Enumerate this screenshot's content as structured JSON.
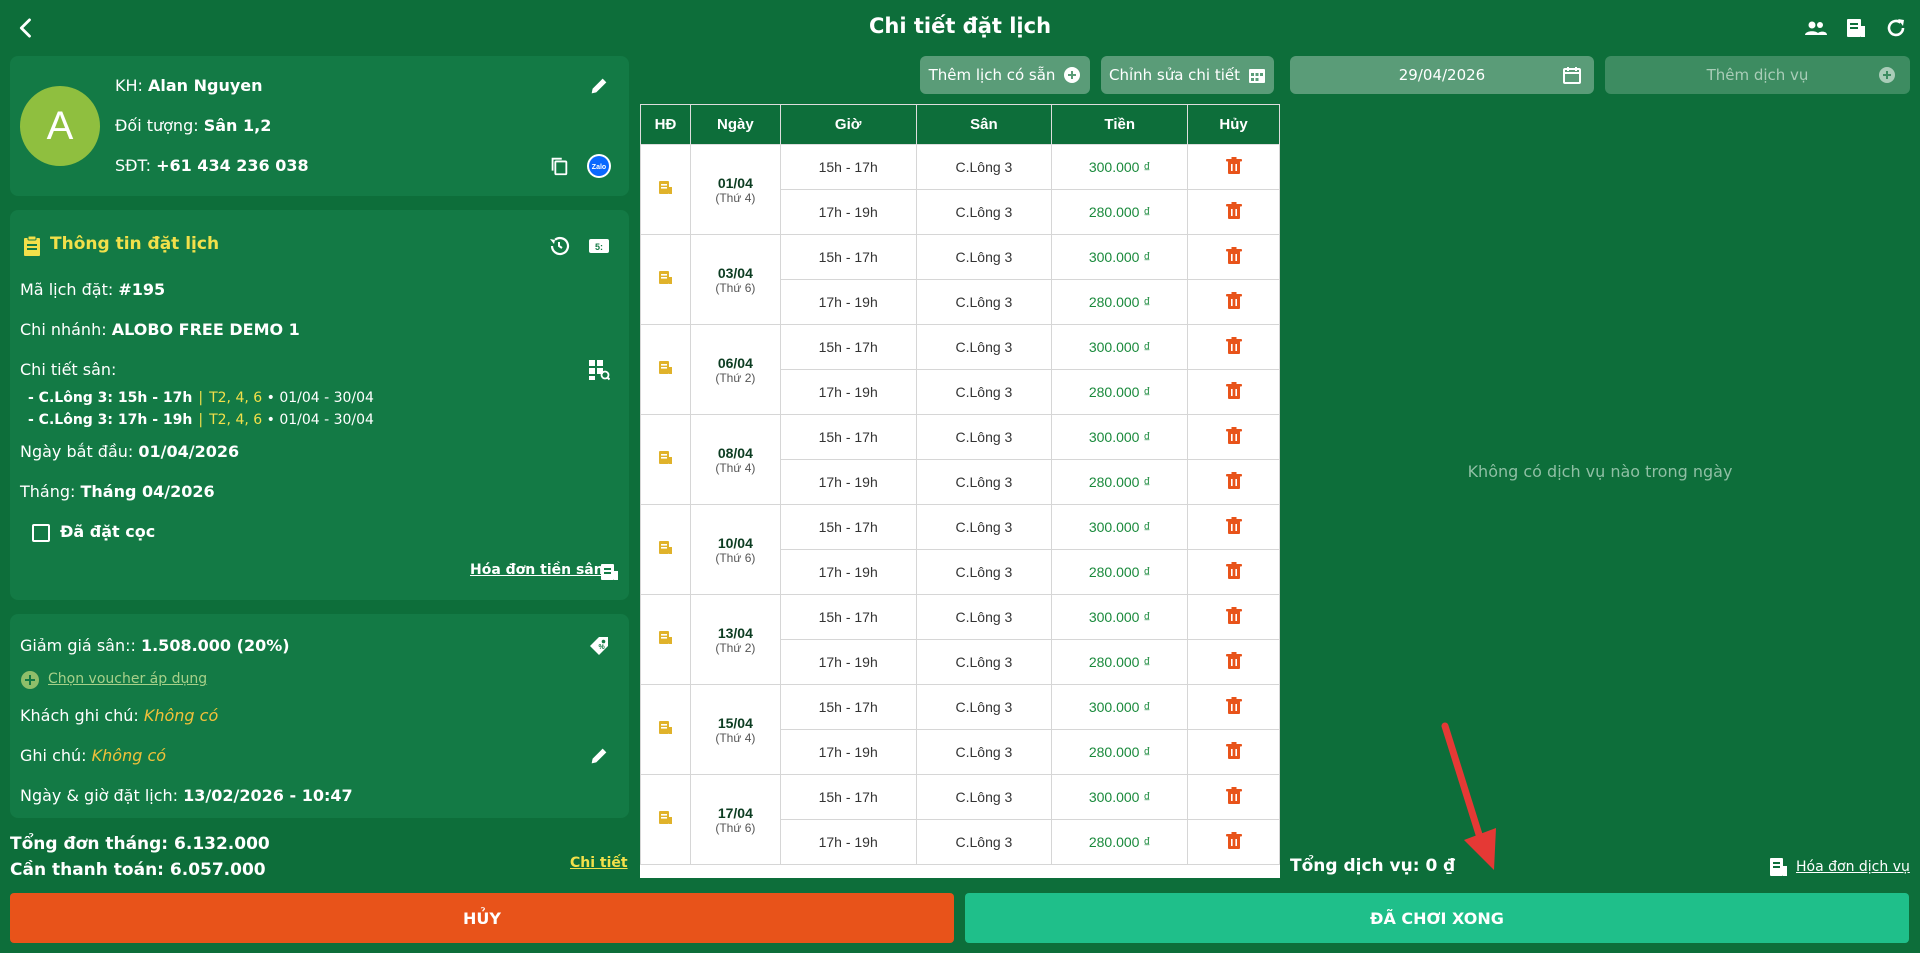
{
  "header": {
    "title": "Chi tiết đặt lịch"
  },
  "customer": {
    "avatar_letter": "A",
    "name_label": "KH:",
    "name": "Alan Nguyen",
    "target_label": "Đối tượng:",
    "target": "Sân 1,2",
    "phone_label": "SĐT:",
    "phone": "+61 434 236 038",
    "zalo_label": "Zalo"
  },
  "booking": {
    "title": "Thông tin đặt lịch",
    "code_label": "Mã lịch đặt:",
    "code": "#195",
    "branch_label": "Chi nhánh:",
    "branch": "ALOBO FREE DEMO 1",
    "court_detail_label": "Chi tiết sân:",
    "courts": [
      {
        "name": "- C.Lông 3: 15h - 17h",
        "sep": "|",
        "days": "T2, 4, 6",
        "range": "• 01/04 - 30/04"
      },
      {
        "name": "- C.Lông 3: 17h - 19h",
        "sep": "|",
        "days": "T2, 4, 6",
        "range": "• 01/04 - 30/04"
      }
    ],
    "start_label": "Ngày bắt đầu:",
    "start": "01/04/2026",
    "month_label": "Tháng:",
    "month": "Tháng 04/2026",
    "deposit_label": "Đã đặt cọc",
    "invoice_link": "Hóa đơn tiền sân"
  },
  "extra": {
    "discount_label": "Giảm giá sân::",
    "discount": "1.508.000 (20%)",
    "voucher_link": "Chọn voucher áp dụng",
    "customer_note_label": "Khách ghi chú:",
    "customer_note": "Không có",
    "note_label": "Ghi chú:",
    "note": "Không có",
    "booked_at_label": "Ngày & giờ đặt lịch:",
    "booked_at": "13/02/2026 - 10:47"
  },
  "totals": {
    "month_total_label": "Tổng đơn tháng:",
    "month_total": "6.132.000",
    "to_pay_label": "Cần thanh toán:",
    "to_pay": "6.057.000",
    "detail_link": "Chi tiết"
  },
  "toolbar": {
    "add_existing": "Thêm lịch có sẵn",
    "edit_detail": "Chỉnh sửa chi tiết",
    "date": "29/04/2026",
    "add_service": "Thêm dịch vụ"
  },
  "table": {
    "headers": [
      "HĐ",
      "Ngày",
      "Giờ",
      "Sân",
      "Tiền",
      "Hủy"
    ],
    "days": [
      {
        "date": "01/04",
        "weekday": "(Thứ 4)",
        "slots": [
          {
            "time": "15h - 17h",
            "court": "C.Lông 3",
            "price": "300.000 ₫"
          },
          {
            "time": "17h - 19h",
            "court": "C.Lông 3",
            "price": "280.000 ₫"
          }
        ]
      },
      {
        "date": "03/04",
        "weekday": "(Thứ 6)",
        "slots": [
          {
            "time": "15h - 17h",
            "court": "C.Lông 3",
            "price": "300.000 ₫"
          },
          {
            "time": "17h - 19h",
            "court": "C.Lông 3",
            "price": "280.000 ₫"
          }
        ]
      },
      {
        "date": "06/04",
        "weekday": "(Thứ 2)",
        "slots": [
          {
            "time": "15h - 17h",
            "court": "C.Lông 3",
            "price": "300.000 ₫"
          },
          {
            "time": "17h - 19h",
            "court": "C.Lông 3",
            "price": "280.000 ₫"
          }
        ]
      },
      {
        "date": "08/04",
        "weekday": "(Thứ 4)",
        "slots": [
          {
            "time": "15h - 17h",
            "court": "C.Lông 3",
            "price": "300.000 ₫"
          },
          {
            "time": "17h - 19h",
            "court": "C.Lông 3",
            "price": "280.000 ₫"
          }
        ]
      },
      {
        "date": "10/04",
        "weekday": "(Thứ 6)",
        "slots": [
          {
            "time": "15h - 17h",
            "court": "C.Lông 3",
            "price": "300.000 ₫"
          },
          {
            "time": "17h - 19h",
            "court": "C.Lông 3",
            "price": "280.000 ₫"
          }
        ]
      },
      {
        "date": "13/04",
        "weekday": "(Thứ 2)",
        "slots": [
          {
            "time": "15h - 17h",
            "court": "C.Lông 3",
            "price": "300.000 ₫"
          },
          {
            "time": "17h - 19h",
            "court": "C.Lông 3",
            "price": "280.000 ₫"
          }
        ]
      },
      {
        "date": "15/04",
        "weekday": "(Thứ 4)",
        "slots": [
          {
            "time": "15h - 17h",
            "court": "C.Lông 3",
            "price": "300.000 ₫"
          },
          {
            "time": "17h - 19h",
            "court": "C.Lông 3",
            "price": "280.000 ₫"
          }
        ]
      },
      {
        "date": "17/04",
        "weekday": "(Thứ 6)",
        "slots": [
          {
            "time": "15h - 17h",
            "court": "C.Lông 3",
            "price": "300.000 ₫"
          },
          {
            "time": "17h - 19h",
            "court": "C.Lông 3",
            "price": "280.000 ₫"
          }
        ]
      }
    ]
  },
  "services": {
    "empty_message": "Không có dịch vụ nào trong ngày",
    "total_label": "Tổng dịch vụ:",
    "total": "0 ₫",
    "invoice_link": "Hóa đơn dịch vụ"
  },
  "actions": {
    "cancel": "HỦY",
    "done": "ĐÃ CHƠI XONG"
  },
  "colors": {
    "background": "#0d6e3a",
    "panel": "#137a45",
    "cancel": "#e8531a",
    "done": "#1fbf8a",
    "accent_yellow": "#f2e04a",
    "trash": "#e8531a",
    "annotation_arrow": "#e53935"
  }
}
